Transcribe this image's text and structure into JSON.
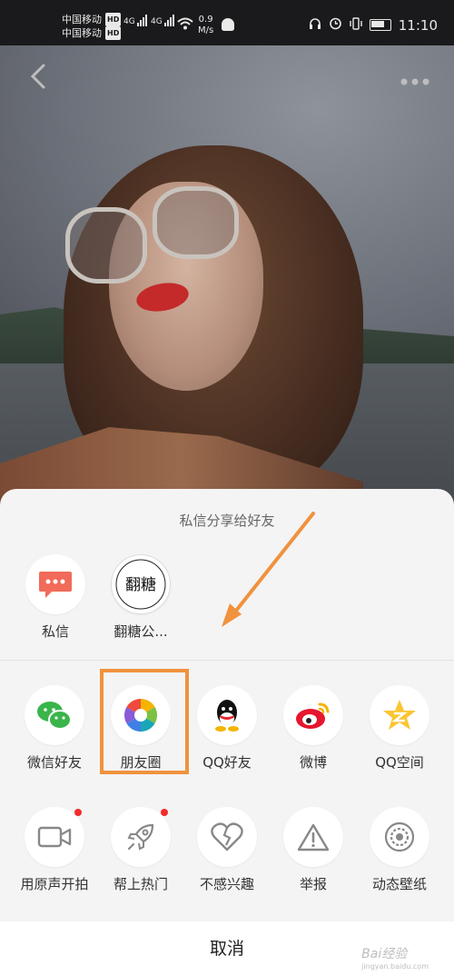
{
  "status_bar": {
    "carrier1": "中国移动",
    "carrier2": "中国移动",
    "hd": "HD",
    "net1": "4G",
    "net2": "4G",
    "speed_value": "0.9",
    "speed_unit": "M/s",
    "time": "11:10"
  },
  "share_sheet": {
    "title": "私信分享给好友",
    "contacts": [
      {
        "label": "私信",
        "icon": "message-icon"
      },
      {
        "label": "翻糖公...",
        "icon": "fantang-avatar"
      }
    ],
    "share_row": [
      {
        "label": "微信好友",
        "icon": "wechat-icon"
      },
      {
        "label": "朋友圈",
        "icon": "moments-icon"
      },
      {
        "label": "QQ好友",
        "icon": "qq-icon"
      },
      {
        "label": "微博",
        "icon": "weibo-icon"
      },
      {
        "label": "QQ空间",
        "icon": "qzone-icon"
      }
    ],
    "action_row": [
      {
        "label": "用原声开拍",
        "icon": "video-camera-icon",
        "badge": true
      },
      {
        "label": "帮上热门",
        "icon": "rocket-icon",
        "badge": true
      },
      {
        "label": "不感兴趣",
        "icon": "broken-heart-icon",
        "badge": false
      },
      {
        "label": "举报",
        "icon": "warning-icon",
        "badge": false
      },
      {
        "label": "动态壁纸",
        "icon": "wallpaper-icon",
        "badge": false
      }
    ],
    "cancel_label": "取消"
  },
  "avatar_text": "翻糖",
  "watermark": {
    "brand": "Bai经验",
    "url": "jingyan.baidu.com"
  },
  "colors": {
    "highlight": "#f0923e",
    "badge": "#f22b2b",
    "sheet_bg": "#f4f4f4"
  }
}
